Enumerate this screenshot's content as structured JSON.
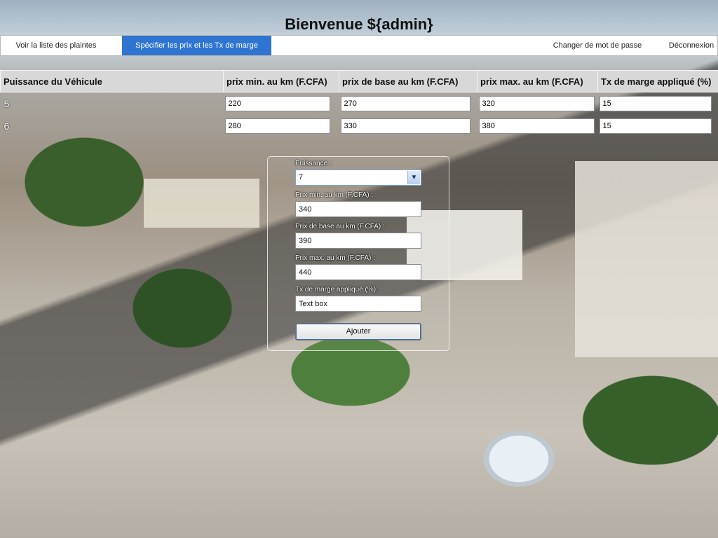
{
  "page": {
    "title": "Bienvenue ${admin}"
  },
  "menu": {
    "complaints_label": "Voir la liste des plaintes",
    "prices_label": "Spécifier les prix et les Tx de marge",
    "password_label": "Changer de mot de passe",
    "logout_label": "Déconnexion"
  },
  "table": {
    "headers": {
      "power": "Puissance du Véhicule",
      "min_price": "prix min. au km (F.CFA)",
      "base_price": "prix de base au km (F.CFA)",
      "max_price": "prix max. au km (F.CFA)",
      "margin": "Tx de marge appliqué (%)"
    },
    "rows": [
      {
        "power": "5",
        "min": "220",
        "base": "270",
        "max": "320",
        "margin": "15"
      },
      {
        "power": "6",
        "min": "280",
        "base": "330",
        "max": "380",
        "margin": "15"
      }
    ]
  },
  "form": {
    "power_label": "Puissance :",
    "power_value": "7",
    "min_label": "Prix min. au km (F.CFA) :",
    "min_value": "340",
    "base_label": "Prix de base au km (F.CFA) :",
    "base_value": "390",
    "max_label": "Prix max. au km (F.CFA) :",
    "max_value": "440",
    "margin_label": "Tx de marge appliqué (%):",
    "margin_value": "Text box",
    "submit_label": "Ajouter"
  },
  "icons": {
    "select_arrow": "chevron-down-icon"
  },
  "colors": {
    "accent": "#2f74d0",
    "header_bg": "#d8d8d8"
  }
}
